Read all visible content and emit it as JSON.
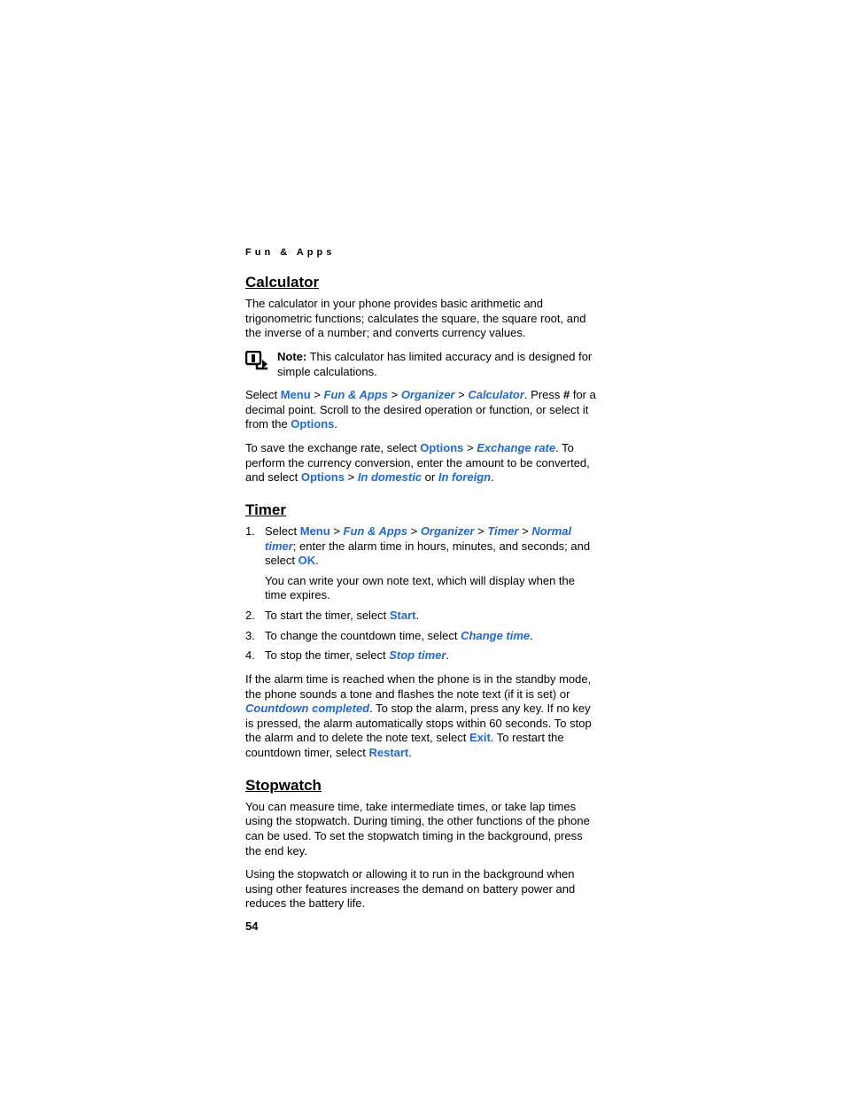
{
  "header": {
    "running": "Fun & Apps"
  },
  "calculator": {
    "heading": "Calculator",
    "intro": "The calculator in your phone provides basic arithmetic and trigonometric functions; calculates the square, the square root, and the inverse of a number; and converts currency values.",
    "note_label": "Note:",
    "note_body": " This calculator has limited accuracy and is designed for simple calculations.",
    "p2": {
      "select": "Select ",
      "menu": "Menu",
      "sep": " > ",
      "fun": "Fun & Apps",
      "organizer": "Organizer",
      "calculator": "Calculator",
      "tail1": ". Press ",
      "hash": "#",
      "tail2": " for a decimal point. Scroll to the desired operation or function, or select it from the ",
      "options": "Options",
      "period": "."
    },
    "p3": {
      "a": "To save the exchange rate, select ",
      "options": "Options",
      "sep": " > ",
      "exrate": "Exchange rate",
      "b": ". To perform the currency conversion, enter the amount to be converted, and select ",
      "options2": "Options",
      "sep2": " > ",
      "indom": "In domestic",
      "or": " or ",
      "infor": "In foreign",
      "period": "."
    }
  },
  "timer": {
    "heading": "Timer",
    "step1": {
      "select": "Select ",
      "menu": "Menu",
      "sep": " > ",
      "fun": "Fun & Apps",
      "organizer": "Organizer",
      "timer": "Timer",
      "normal": "Normal timer",
      "tail": "; enter the alarm time in hours, minutes, and seconds; and select ",
      "ok": "OK",
      "period": ".",
      "note": "You can write your own note text, which will display when the time expires."
    },
    "step2": {
      "a": "To start the timer, select ",
      "start": "Start",
      "period": "."
    },
    "step3": {
      "a": "To change the countdown time, select ",
      "change": "Change time",
      "period": "."
    },
    "step4": {
      "a": "To stop the timer, select ",
      "stop": "Stop timer",
      "period": "."
    },
    "p_after": {
      "a": "If the alarm time is reached when the phone is in the standby mode, the phone sounds a tone and flashes the note text (if it is set) or ",
      "cc": "Countdown completed",
      "b": ". To stop the alarm, press any key. If no key is pressed, the alarm automatically stops within 60 seconds. To stop the alarm and to delete the note text, select ",
      "exit": "Exit",
      "c": ". To restart the countdown timer, select ",
      "restart": "Restart",
      "period": "."
    }
  },
  "stopwatch": {
    "heading": "Stopwatch",
    "p1": "You can measure time, take intermediate times, or take lap times using the stopwatch. During timing, the other functions of the phone can be used. To set the stopwatch timing in the background, press the end key.",
    "p2": "Using the stopwatch or allowing it to run in the background when using other features increases the demand on battery power and reduces the battery life."
  },
  "page_number": "54"
}
